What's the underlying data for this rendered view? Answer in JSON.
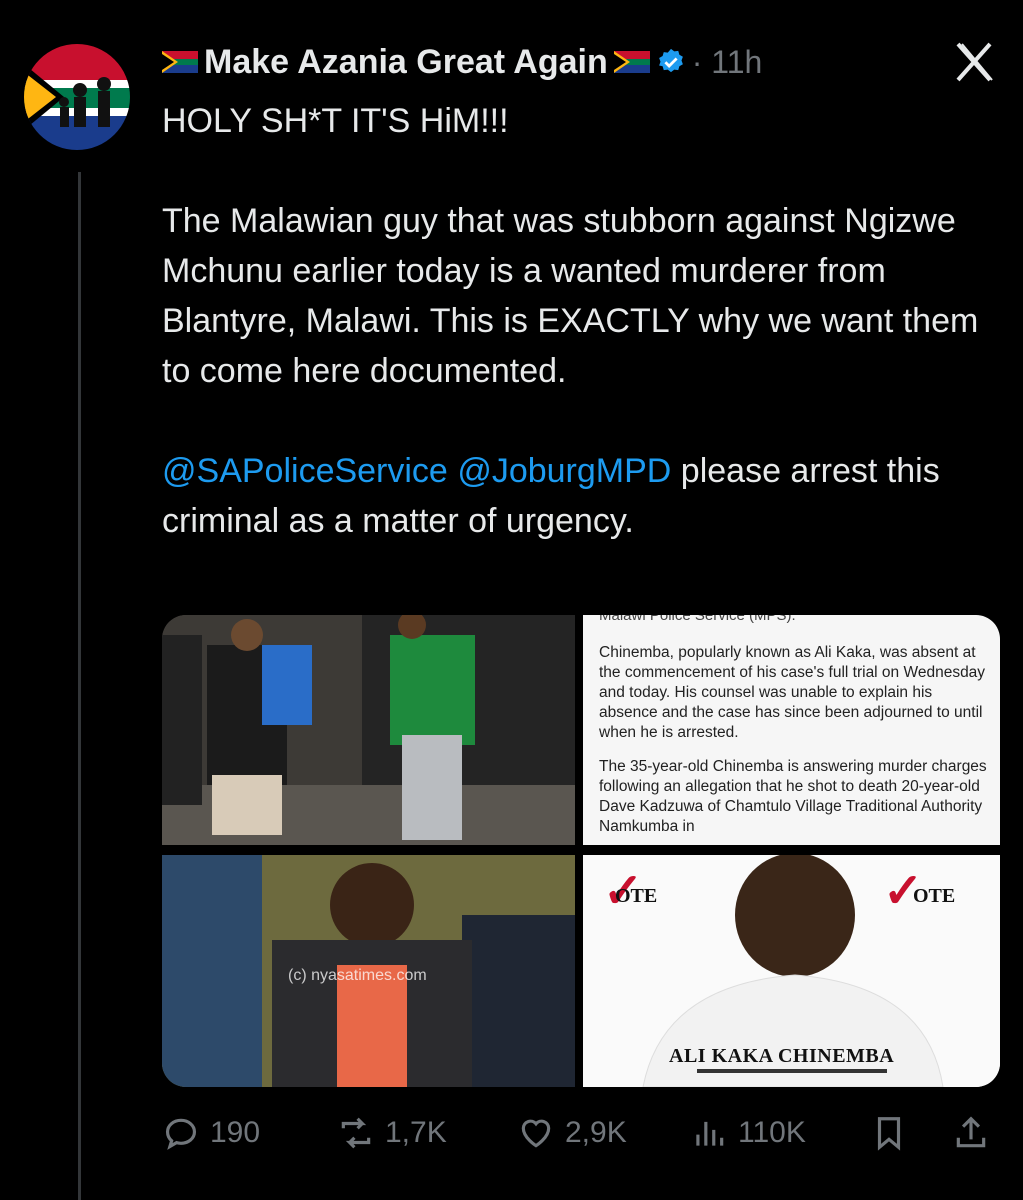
{
  "tweet": {
    "author_name": "Make Azania Great Again",
    "time": "11h",
    "paragraphs": {
      "p1": "HOLY SH*T IT'S  HiM!!!",
      "p2": "The Malawian guy that was stubborn against Ngizwe Mchunu earlier today is a wanted murderer from Blantyre, Malawi. This is EXACTLY why we want them to come here documented.",
      "mention1": "@SAPoliceService",
      "mention2": "@JoburgMPD",
      "p3_rest": " please arrest this criminal as a matter of urgency."
    }
  },
  "media": {
    "article_top": "Malawi Police Service (MPS).",
    "article_p1": "Chinemba, popularly known as Ali Kaka, was absent at the commencement of his case's full trial on Wednesday and today. His counsel was unable to explain his absence and the case has since been adjourned to until when he is arrested.",
    "article_p2": "The 35-year-old Chinemba is answering murder charges following an allegation that he shot to death 20-year-old Dave Kadzuwa of Chamtulo Village Traditional Authority Namkumba in",
    "watermark": "(c) nyasatimes.com",
    "vote_label": "OTE",
    "candidate_name": "ALI KAKA CHINEMBA"
  },
  "actions": {
    "replies": "190",
    "reposts": "1,7K",
    "likes": "2,9K",
    "views": "110K"
  },
  "colors": {
    "background": "#000000",
    "text": "#e7e9ea",
    "secondary": "#71767b",
    "accent": "#1d9bf0"
  },
  "icons": [
    "reply-icon",
    "repost-icon",
    "like-icon",
    "views-icon",
    "bookmark-icon",
    "share-icon",
    "verified-icon",
    "close-icon"
  ]
}
